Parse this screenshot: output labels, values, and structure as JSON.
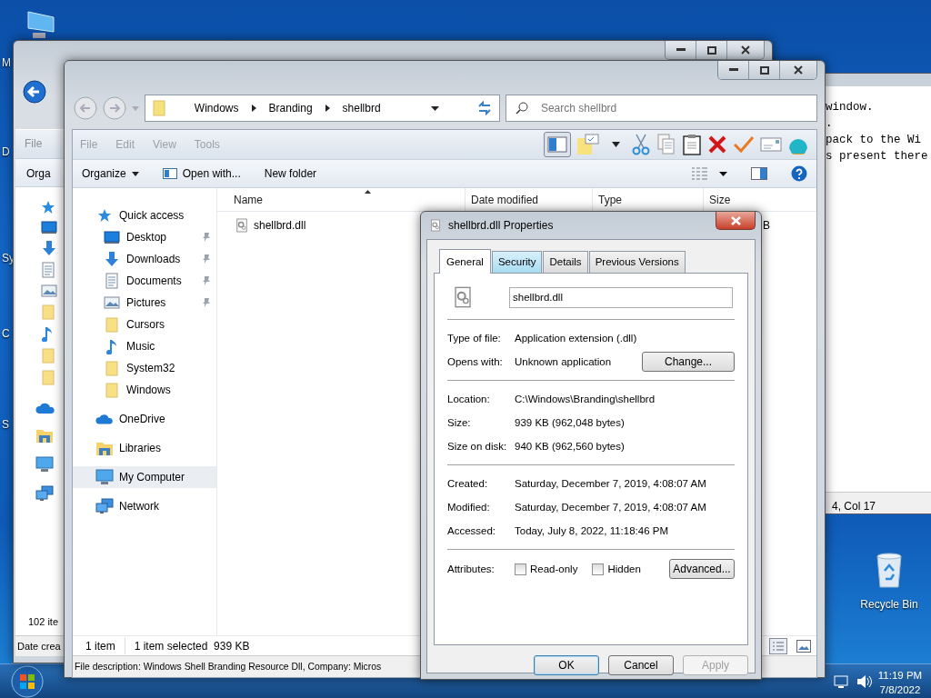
{
  "desktop": {
    "edge_labels": [
      {
        "label": "M"
      },
      {
        "label": "D"
      },
      {
        "label": "Sy"
      },
      {
        "label": "C"
      },
      {
        "label": "S"
      }
    ],
    "recycle_bin": {
      "label": "Recycle Bin"
    }
  },
  "back_window": {
    "menu": "File",
    "command": "Orga",
    "status": "102 ite",
    "details": "Date crea"
  },
  "notepad": {
    "lines": [
      "window.",
      ".",
      "pack to the Wi",
      "s present there"
    ],
    "status": "4, Col 17"
  },
  "explorer": {
    "breadcrumb": [
      "Windows",
      "Branding",
      "shellbrd"
    ],
    "search": {
      "placeholder": "Search shellbrd"
    },
    "menu": [
      "File",
      "Edit",
      "View",
      "Tools"
    ],
    "toolbar": [
      {
        "kind": "pane",
        "selected": true
      },
      {
        "kind": "note",
        "selected": false
      },
      {
        "kind": "caret",
        "selected": false
      },
      {
        "kind": "cut",
        "selected": false
      },
      {
        "kind": "copy",
        "selected": false
      },
      {
        "kind": "paste",
        "selected": false
      },
      {
        "kind": "delete",
        "selected": false
      },
      {
        "kind": "check",
        "selected": false
      },
      {
        "kind": "mail",
        "selected": false
      },
      {
        "kind": "shell",
        "selected": false
      }
    ],
    "commands": [
      {
        "label": "Organize",
        "kind": "menu"
      },
      {
        "label": "Open with...",
        "kind": "open"
      },
      {
        "label": "New folder",
        "kind": "plain"
      }
    ],
    "nav": [
      {
        "label": "Quick access",
        "selected": false,
        "children": [
          {
            "label": "Desktop",
            "pinned": true,
            "selected": false
          },
          {
            "label": "Downloads",
            "pinned": true,
            "selected": false
          },
          {
            "label": "Documents",
            "pinned": true,
            "selected": false
          },
          {
            "label": "Pictures",
            "pinned": true,
            "selected": false
          },
          {
            "label": "Cursors",
            "pinned": false,
            "selected": false
          },
          {
            "label": "Music",
            "pinned": false,
            "selected": false
          },
          {
            "label": "System32",
            "pinned": false,
            "selected": false
          },
          {
            "label": "Windows",
            "pinned": false,
            "selected": false
          }
        ]
      },
      {
        "label": "OneDrive",
        "selected": false
      },
      {
        "label": "Libraries",
        "selected": false
      },
      {
        "label": "My Computer",
        "selected": true
      },
      {
        "label": "Network",
        "selected": false
      }
    ],
    "columns": [
      "Name",
      "Date modified",
      "Type",
      "Size"
    ],
    "files": [
      {
        "name": "shellbrd.dll",
        "size": "B"
      }
    ],
    "status": [
      "1 item",
      "1 item selected  939 KB"
    ],
    "description": "File description: Windows Shell Branding Resource Dll, Company: Micros"
  },
  "dialog": {
    "title": "shellbrd.dll Properties",
    "tabs": [
      {
        "label": "General",
        "selected": true,
        "hovered": false
      },
      {
        "label": "Security",
        "selected": false,
        "hovered": true
      },
      {
        "label": "Details",
        "selected": false,
        "hovered": false
      },
      {
        "label": "Previous Versions",
        "selected": false,
        "hovered": false
      }
    ],
    "file_name": "shellbrd.dll",
    "sections": [
      [
        {
          "label": "Type of file:",
          "value": "Application extension (.dll)"
        },
        {
          "label": "Opens with:",
          "value": "Unknown application",
          "button": "Change..."
        }
      ],
      [
        {
          "label": "Location:",
          "value": "C:\\Windows\\Branding\\shellbrd"
        },
        {
          "label": "Size:",
          "value": "939 KB (962,048 bytes)"
        },
        {
          "label": "Size on disk:",
          "value": "940 KB (962,560 bytes)"
        }
      ],
      [
        {
          "label": "Created:",
          "value": "Saturday, December 7, 2019, 4:08:07 AM"
        },
        {
          "label": "Modified:",
          "value": "Saturday, December 7, 2019, 4:08:07 AM"
        },
        {
          "label": "Accessed:",
          "value": "Today, July 8, 2022, 11:18:46 PM"
        }
      ]
    ],
    "attributes": {
      "label": "Attributes:",
      "checkboxes": [
        {
          "label": "Read-only",
          "checked": false
        },
        {
          "label": "Hidden",
          "checked": false
        }
      ],
      "button": "Advanced..."
    },
    "buttons": [
      {
        "label": "OK",
        "default": true,
        "disabled": false
      },
      {
        "label": "Cancel",
        "default": false,
        "disabled": false
      },
      {
        "label": "Apply",
        "default": false,
        "disabled": true
      }
    ]
  },
  "taskbar": {
    "time": "11:19 PM",
    "date": "7/8/2022"
  }
}
